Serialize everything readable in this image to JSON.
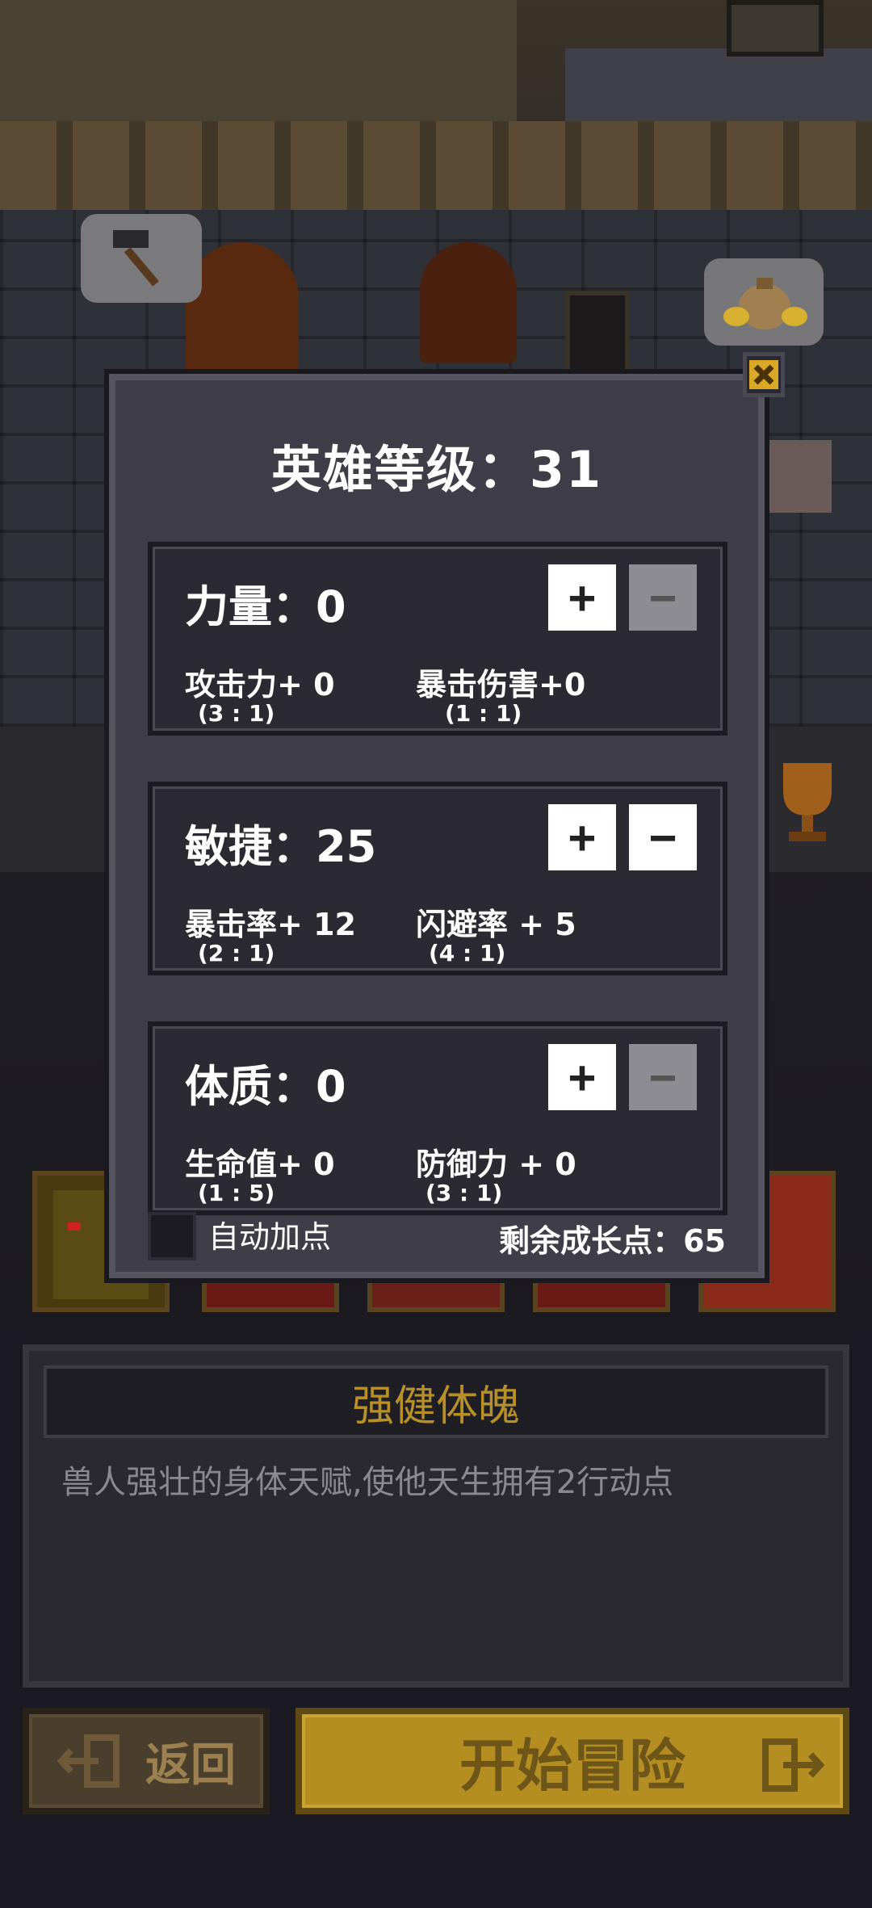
{
  "panel": {
    "title": "英雄等级：31",
    "close_icon": "close-x-icon",
    "stats": [
      {
        "name": "力量：0",
        "plus_label": "+",
        "minus_label": "−",
        "minus_enabled": false,
        "sub": [
          {
            "label": "攻击力+ 0",
            "ratio": "(3 : 1)"
          },
          {
            "label": "暴击伤害+0",
            "ratio": "(1 : 1)"
          }
        ]
      },
      {
        "name": "敏捷：25",
        "plus_label": "+",
        "minus_label": "−",
        "minus_enabled": true,
        "sub": [
          {
            "label": "暴击率+ 12",
            "ratio": "(2 : 1)"
          },
          {
            "label": "闪避率 + 5",
            "ratio": "(4 : 1)"
          }
        ]
      },
      {
        "name": "体质：0",
        "plus_label": "+",
        "minus_label": "−",
        "minus_enabled": false,
        "sub": [
          {
            "label": "生命值+ 0",
            "ratio": "(1 : 5)"
          },
          {
            "label": "防御力 + 0",
            "ratio": "(3 : 1)"
          }
        ]
      }
    ],
    "auto_label": "自动加点",
    "remaining": "剩余成长点：65"
  },
  "description": {
    "title": "强健体魄",
    "text": "兽人强壮的身体天赋,使他天生拥有2行动点"
  },
  "buttons": {
    "back_label": "返回",
    "start_label": "开始冒险"
  },
  "icons": [
    "hammer-icon",
    "coin-bag-icon",
    "trophy-icon",
    "back-door-icon",
    "exit-door-icon"
  ],
  "colors": {
    "accent_gold": "#b58e22",
    "title_gold": "#b8902a",
    "panel_bg": "#3f3e48"
  }
}
